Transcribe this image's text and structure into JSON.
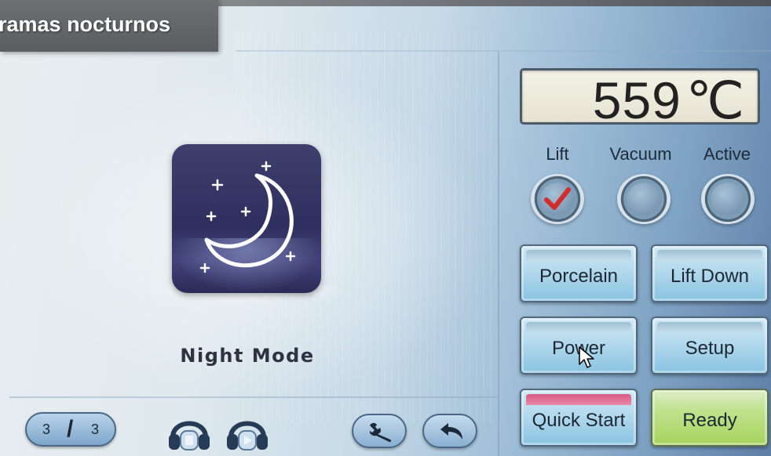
{
  "title": "ramas nocturnos",
  "mode": {
    "label": "Night Mode",
    "icon": "moon-stars-icon"
  },
  "temperature": {
    "value": "559",
    "unit": "℃"
  },
  "indicators": [
    {
      "label": "Lift",
      "checked": true
    },
    {
      "label": "Vacuum",
      "checked": false
    },
    {
      "label": "Active",
      "checked": false
    }
  ],
  "buttons": {
    "porcelain": "Porcelain",
    "lift_down": "Lift Down",
    "power": "Power",
    "setup": "Setup",
    "quick_start": "Quick Start",
    "ready": "Ready"
  },
  "pager": {
    "current": "3",
    "total": "3"
  },
  "colors": {
    "check": "#d42b2b",
    "quick_start_accent": "#d85a86",
    "ready_accent": "#a6d35a"
  }
}
